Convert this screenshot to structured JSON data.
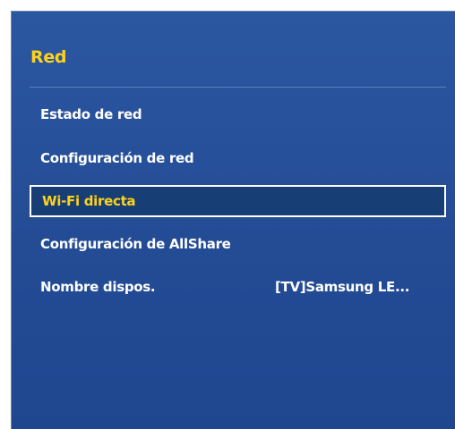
{
  "menu": {
    "title": "Red",
    "items": [
      {
        "label": "Estado de red"
      },
      {
        "label": "Configuración de red"
      },
      {
        "label": "Wi-Fi directa"
      },
      {
        "label": "Configuración de AllShare"
      },
      {
        "label": "Nombre dispos.",
        "value": "[TV]Samsung LE..."
      }
    ]
  },
  "colors": {
    "panel_background": "#2452a0",
    "title_color": "#ffd21a",
    "selected_background": "#173e75",
    "selected_text": "#ffd21a",
    "text": "#ffffff"
  }
}
